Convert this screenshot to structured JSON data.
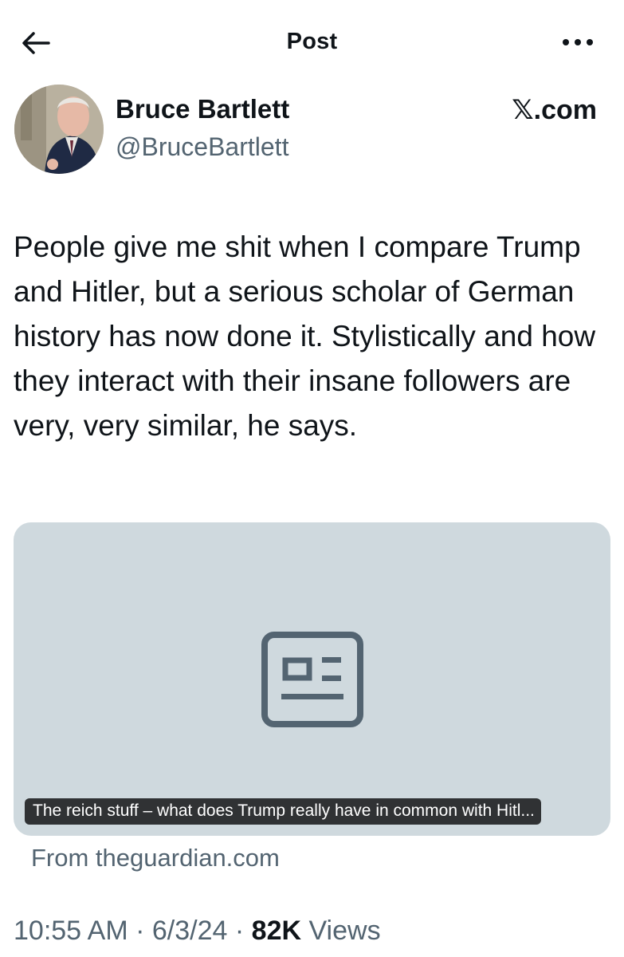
{
  "header": {
    "title": "Post",
    "back_icon": "arrow-left-icon",
    "more_icon": "more-horizontal-icon"
  },
  "author": {
    "name": "Bruce Bartlett",
    "handle": "@BruceBartlett",
    "source_brand": "𝕏.com"
  },
  "post": {
    "text": "People give me shit when I compare Trump and Hitler, but a serious scholar of German history has now done it. Stylistically and how they interact with their insane followers are very, very similar, he says."
  },
  "card": {
    "icon": "news-article-icon",
    "title": "The reich stuff – what does Trump really have in common with Hitl...",
    "source": "From theguardian.com"
  },
  "meta": {
    "time": "10:55 AM",
    "separator": "·",
    "date": "6/3/24",
    "views_count": "82K",
    "views_label": "Views"
  },
  "colors": {
    "text_primary": "#0f1419",
    "text_secondary": "#536471",
    "card_background": "#cfd9de",
    "card_icon": "#536471"
  }
}
